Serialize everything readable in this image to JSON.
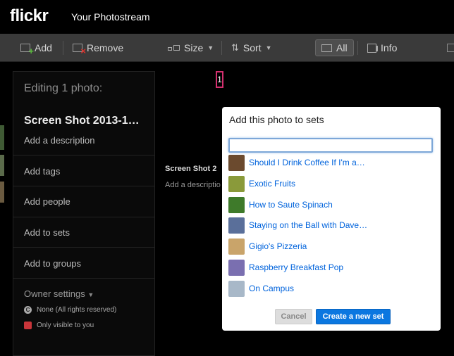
{
  "header": {
    "logo": "flickr",
    "title": "Your Photostream"
  },
  "toolbar": {
    "add_label": "Add",
    "remove_label": "Remove",
    "size_label": "Size",
    "sort_label": "Sort",
    "all_label": "All",
    "info_label": "Info"
  },
  "sidebar": {
    "heading": "Editing 1 photo:",
    "photo_title": "Screen Shot 2013-1…",
    "description_placeholder": "Add a description",
    "items": [
      "Add tags",
      "Add people",
      "Add to sets",
      "Add to groups"
    ],
    "owner_settings": "Owner settings",
    "license": "None (All rights reserved)",
    "privacy": "Only visible to you"
  },
  "marker": "1",
  "background_photo": {
    "title": "Screen Shot 2",
    "description": "Add a descriptio"
  },
  "dialog": {
    "title": "Add this photo to sets",
    "search_value": "",
    "sets": [
      {
        "label": "Should I Drink Coffee If I'm a…",
        "color": "#6b4a2e"
      },
      {
        "label": "Exotic Fruits",
        "color": "#8a9a3a"
      },
      {
        "label": "How to Saute Spinach",
        "color": "#3e7a2a"
      },
      {
        "label": "Staying on the Ball with Dave…",
        "color": "#5a6f9a"
      },
      {
        "label": "Gigio's Pizzeria",
        "color": "#c9a46a"
      },
      {
        "label": "Raspberry Breakfast Pop",
        "color": "#7a6fb0"
      },
      {
        "label": "On Campus",
        "color": "#a8b8c8"
      }
    ],
    "cancel_label": "Cancel",
    "create_label": "Create a new set"
  },
  "colors": {
    "accent": "#0b77e0",
    "link": "#0063dc",
    "toolbar_bg": "#3a3a3a",
    "marker": "#d4306f"
  }
}
